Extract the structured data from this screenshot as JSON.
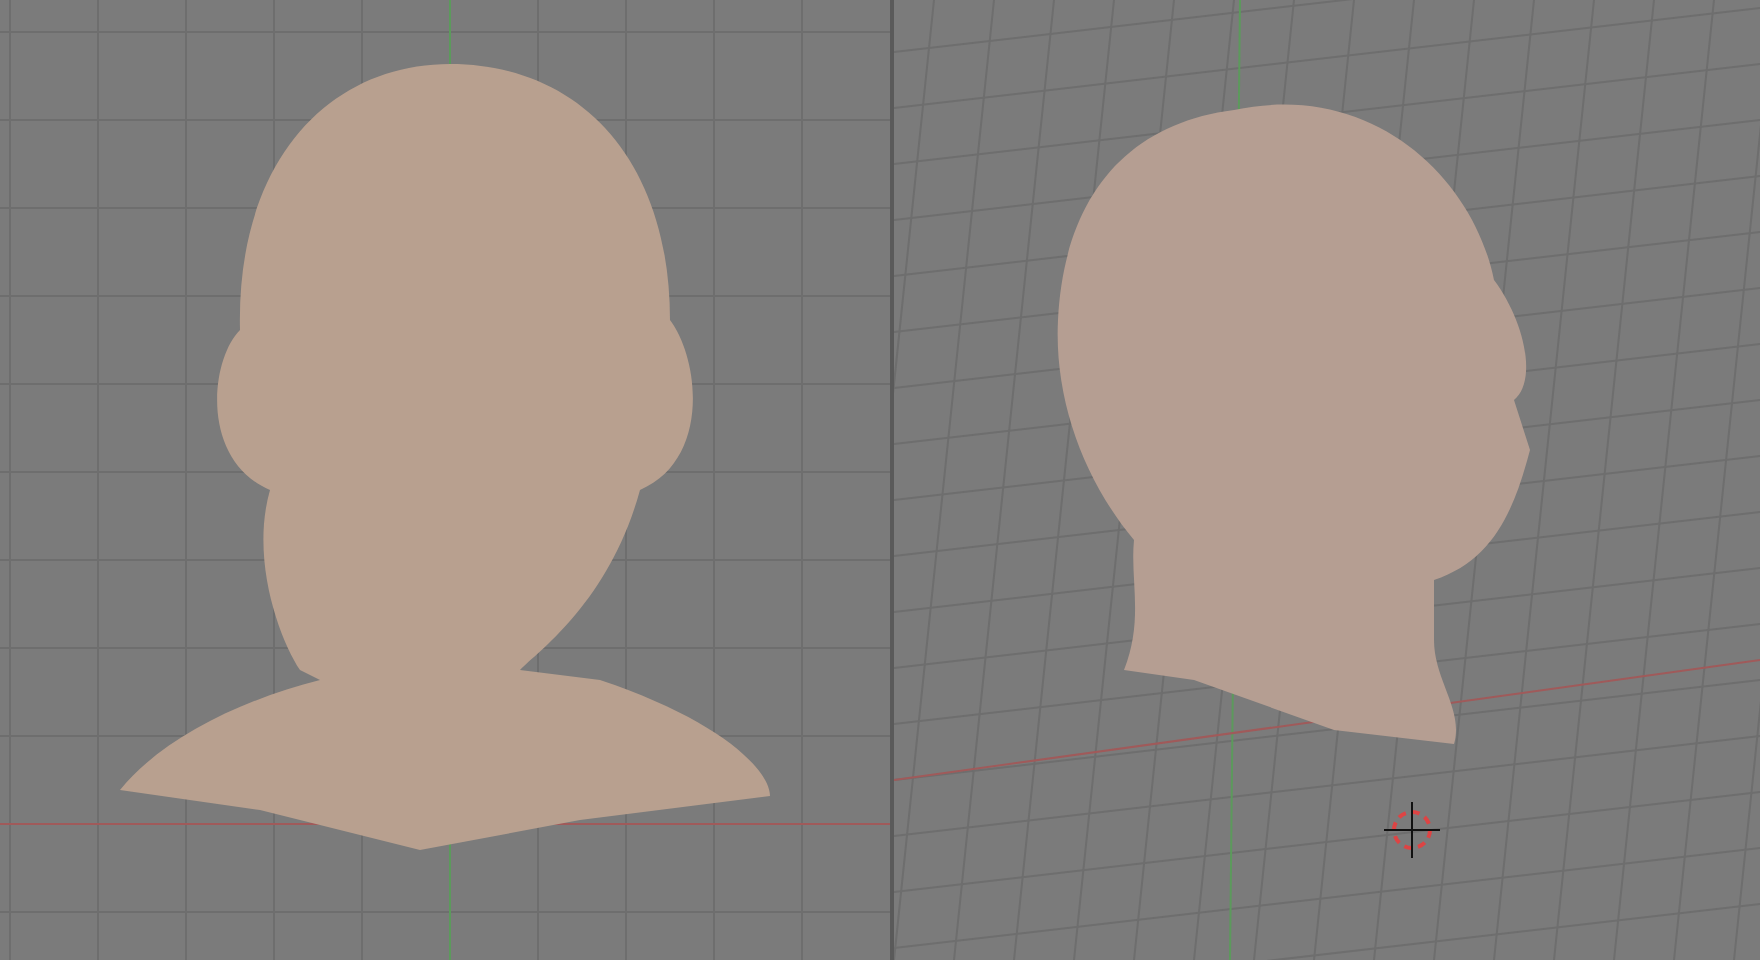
{
  "viewports": [
    {
      "kind": "orthographic",
      "cursor": false
    },
    {
      "kind": "perspective",
      "cursor": true
    }
  ]
}
